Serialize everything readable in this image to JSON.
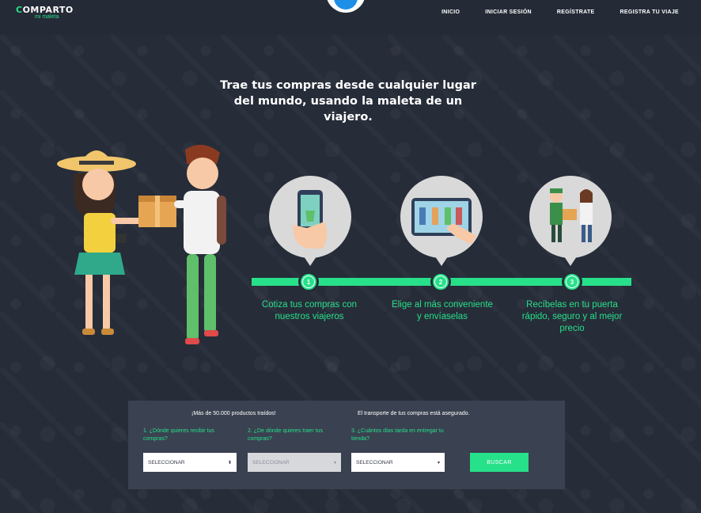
{
  "header": {
    "logo_main_c": "C",
    "logo_main_rest": "OMPARTO",
    "logo_sub": "mi maleta",
    "nav": [
      "INICIO",
      "INICIAR SESIÓN",
      "REGÍSTRATE",
      "REGISTRA TU VIAJE"
    ]
  },
  "hero": {
    "headline": "Trae tus compras desde cualquier lugar del mundo, usando la maleta de un viajero."
  },
  "steps": [
    {
      "number": "1",
      "text": "Cotiza tus compras con nuestros viajeros"
    },
    {
      "number": "2",
      "text": "Elige al más conveniente y envíaselas"
    },
    {
      "number": "3",
      "text": "Recíbelas en tu puerta rápido, seguro y al mejor precio"
    }
  ],
  "form": {
    "note_1": "¡Más de 50.000 productos traídos!",
    "note_2": "El transporte de tus compras está asegurado.",
    "q1": "1. ¿Dónde quieres recibir tus compras?",
    "q2": "2. ¿De dónde quieres traer tus compras?",
    "q3": "3. ¿Cuántos días tarda en entregar tu tienda?",
    "select_1": "SELECCIONAR",
    "select_2": "SELECCIONAR",
    "select_3": "SELECCIONAR",
    "button": "BUSCAR"
  },
  "colors": {
    "accent": "#27e08a",
    "background": "#262c38",
    "panel": "#3a4150"
  },
  "icons": [
    "phone-app-icon",
    "tablet-shop-icon",
    "delivery-people-icon"
  ]
}
